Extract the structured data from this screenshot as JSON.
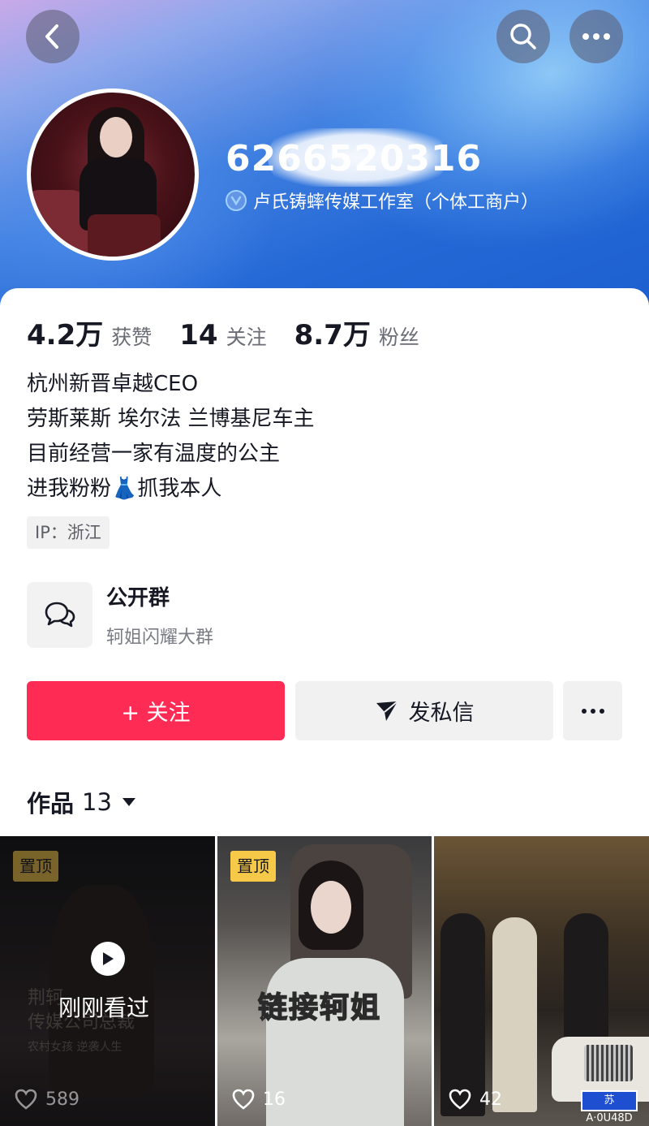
{
  "header": {
    "username": "6266520316",
    "verify_text": "卢氏铸蟀传媒工作室（个体工商户）"
  },
  "stats": [
    {
      "value": "4.2万",
      "label": "获赞"
    },
    {
      "value": "14",
      "label": "关注"
    },
    {
      "value": "8.7万",
      "label": "粉丝"
    }
  ],
  "bio": {
    "line1": "杭州新晋卓越CEO",
    "line2": "劳斯莱斯 埃尔法 兰博基尼车主",
    "line3": "目前经营一家有温度的公主",
    "line4": "进我粉粉👗抓我本人"
  },
  "ip": "IP：浙江",
  "group": {
    "title": "公开群",
    "subtitle": "轲姐闪耀大群"
  },
  "actions": {
    "follow": "+ 关注",
    "message": "发私信"
  },
  "works": {
    "label": "作品",
    "count": "13"
  },
  "videos": [
    {
      "pinned": "置顶",
      "likes": "589",
      "recent": "刚刚看过",
      "bg_text_1": "荆轲",
      "bg_text_2": "传媒公司总裁",
      "bg_text_3": "农村女孩 逆袭人生"
    },
    {
      "pinned": "置顶",
      "likes": "16",
      "overlay": "链接轲姐"
    },
    {
      "likes": "42",
      "plate": "苏A·0U48D"
    }
  ]
}
